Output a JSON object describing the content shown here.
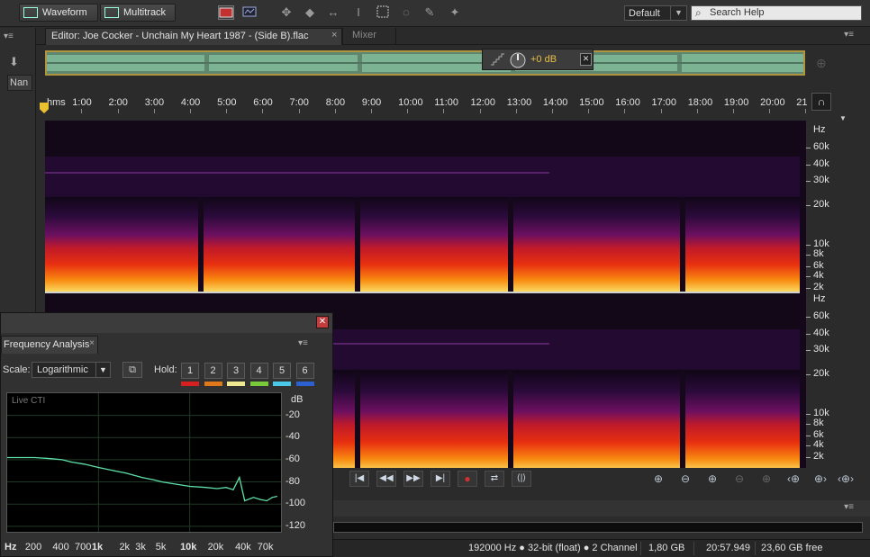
{
  "toolbar": {
    "waveform_label": "Waveform",
    "multitrack_label": "Multitrack",
    "workspace": "Default",
    "search_placeholder": "Search Help"
  },
  "left_panel": {
    "name_column": "Nan"
  },
  "editor": {
    "tab_title": "Editor: Joe Cocker - Unchain My Heart 1987 - (Side B).flac",
    "mixer_tab": "Mixer",
    "volume_readout": "+0 dB"
  },
  "ruler": {
    "unit": "hms",
    "ticks": [
      "1:00",
      "2:00",
      "3:00",
      "4:00",
      "5:00",
      "6:00",
      "7:00",
      "8:00",
      "9:00",
      "10:00",
      "11:00",
      "12:00",
      "13:00",
      "14:00",
      "15:00",
      "16:00",
      "17:00",
      "18:00",
      "19:00",
      "20:00",
      "21"
    ]
  },
  "hz_scale": {
    "unit": "Hz",
    "labels": [
      "60k",
      "40k",
      "30k",
      "20k",
      "10k",
      "8k",
      "6k",
      "4k",
      "2k"
    ]
  },
  "status": {
    "sample_info": "192000 Hz ● 32-bit (float) ● 2 Channel",
    "file_size": "1,80 GB",
    "duration": "20:57.949",
    "free_space": "23,60 GB free"
  },
  "freq_panel": {
    "title": "Frequency Analysis",
    "scale_label": "Scale:",
    "scale_value": "Logarithmic",
    "hold_label": "Hold:",
    "hold_buttons": [
      "1",
      "2",
      "3",
      "4",
      "5",
      "6"
    ],
    "hold_colors": [
      "#d62020",
      "#e0781a",
      "#f0e890",
      "#7ac93a",
      "#49c8e8",
      "#2a60d0"
    ],
    "live_label": "Live CTI",
    "db_unit": "dB",
    "db_labels": [
      "-20",
      "-40",
      "-60",
      "-80",
      "-100",
      "-120"
    ],
    "freq_labels": [
      "Hz",
      "200",
      "400",
      "700",
      "1k",
      "2k",
      "3k",
      "5k",
      "10k",
      "20k",
      "40k",
      "70k"
    ],
    "chart_data": {
      "type": "line",
      "xlabel": "Hz",
      "ylabel": "dB",
      "x_scale": "log",
      "ylim": [
        -125,
        0
      ],
      "series": [
        {
          "x": [
            100,
            200,
            300,
            400,
            500,
            700,
            1000,
            1500,
            2000,
            3000,
            4000,
            5000,
            7000,
            10000,
            15000,
            20000,
            25000,
            30000,
            35000,
            40000,
            50000,
            60000,
            70000,
            80000,
            90000
          ],
          "y": [
            -58,
            -58,
            -59,
            -60,
            -62,
            -64,
            -67,
            -70,
            -72,
            -76,
            -78,
            -80,
            -82,
            -84,
            -85,
            -86,
            -85,
            -87,
            -76,
            -97,
            -94,
            -96,
            -97,
            -94,
            -93
          ]
        }
      ],
      "line_color": "#5ee0a8"
    }
  }
}
